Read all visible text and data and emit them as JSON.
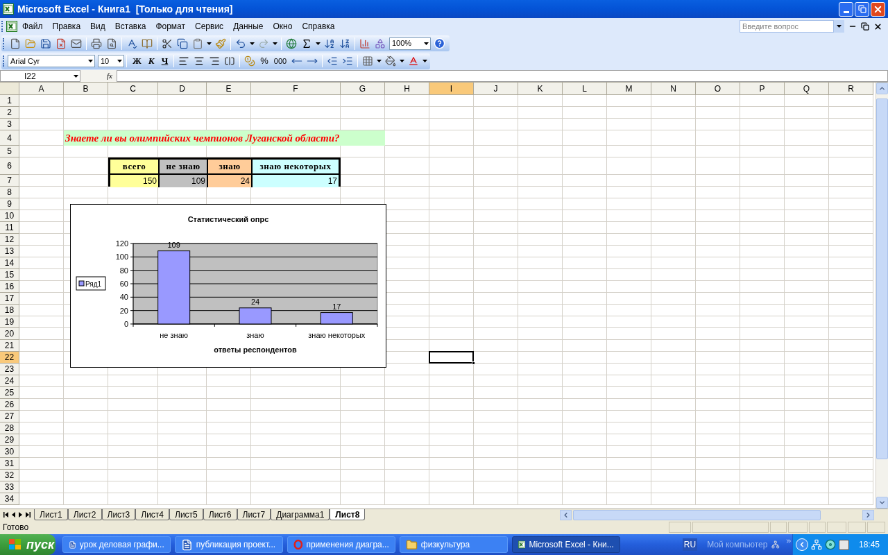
{
  "window": {
    "title": "Microsoft Excel - Книга1  [Только для чтения]"
  },
  "menu": [
    "Файл",
    "Правка",
    "Вид",
    "Вставка",
    "Формат",
    "Сервис",
    "Данные",
    "Окно",
    "Справка"
  ],
  "help_box": {
    "placeholder": "Введите вопрос"
  },
  "toolbar": {
    "zoom": "100%",
    "font": "Arial Cyr",
    "size": "10",
    "bold": "Ж",
    "italic": "К",
    "underline": "Ч",
    "percent": "%",
    "thousands": "000"
  },
  "formula_bar": {
    "name_box": "I22",
    "fx": "fx"
  },
  "columns": [
    {
      "label": "A",
      "selected": false
    },
    {
      "label": "B",
      "selected": false
    },
    {
      "label": "C",
      "selected": false
    },
    {
      "label": "D",
      "selected": false
    },
    {
      "label": "E",
      "selected": false
    },
    {
      "label": "F",
      "selected": false
    },
    {
      "label": "G",
      "selected": false
    },
    {
      "label": "H",
      "selected": false
    },
    {
      "label": "I",
      "selected": true
    },
    {
      "label": "J",
      "selected": false
    },
    {
      "label": "K",
      "selected": false
    },
    {
      "label": "L",
      "selected": false
    },
    {
      "label": "M",
      "selected": false
    },
    {
      "label": "N",
      "selected": false
    },
    {
      "label": "O",
      "selected": false
    },
    {
      "label": "P",
      "selected": false
    },
    {
      "label": "Q",
      "selected": false
    },
    {
      "label": "R",
      "selected": false
    }
  ],
  "rows": [
    {
      "label": "1",
      "selected": false
    },
    {
      "label": "2",
      "selected": false
    },
    {
      "label": "3",
      "selected": false
    },
    {
      "label": "4",
      "selected": false
    },
    {
      "label": "5",
      "selected": false
    },
    {
      "label": "6",
      "selected": false
    },
    {
      "label": "7",
      "selected": false
    },
    {
      "label": "8",
      "selected": false
    },
    {
      "label": "9",
      "selected": false
    },
    {
      "label": "10",
      "selected": false
    },
    {
      "label": "11",
      "selected": false
    },
    {
      "label": "12",
      "selected": false
    },
    {
      "label": "13",
      "selected": false
    },
    {
      "label": "14",
      "selected": false
    },
    {
      "label": "15",
      "selected": false
    },
    {
      "label": "16",
      "selected": false
    },
    {
      "label": "17",
      "selected": false
    },
    {
      "label": "18",
      "selected": false
    },
    {
      "label": "19",
      "selected": false
    },
    {
      "label": "20",
      "selected": false
    },
    {
      "label": "21",
      "selected": false
    },
    {
      "label": "22",
      "selected": true
    },
    {
      "label": "23",
      "selected": false
    },
    {
      "label": "24",
      "selected": false
    },
    {
      "label": "25",
      "selected": false
    },
    {
      "label": "26",
      "selected": false
    },
    {
      "label": "27",
      "selected": false
    },
    {
      "label": "28",
      "selected": false
    },
    {
      "label": "29",
      "selected": false
    },
    {
      "label": "30",
      "selected": false
    },
    {
      "label": "31",
      "selected": false
    },
    {
      "label": "32",
      "selected": false
    },
    {
      "label": "33",
      "selected": false
    },
    {
      "label": "34",
      "selected": false
    }
  ],
  "question": "Знаете ли вы олимпийских чемпионов Луганской области?",
  "table": {
    "headers": [
      {
        "text": "всего",
        "color": "#ffff99"
      },
      {
        "text": "не знаю",
        "color": "#c0c0c0"
      },
      {
        "text": "знаю",
        "color": "#ffcc99"
      },
      {
        "text": "знаю некоторых",
        "color": "#ccffff"
      }
    ],
    "values": [
      {
        "text": "150",
        "color": "#ffff99"
      },
      {
        "text": "109",
        "color": "#c0c0c0"
      },
      {
        "text": "24",
        "color": "#ffcc99"
      },
      {
        "text": "17",
        "color": "#ccffff"
      }
    ]
  },
  "chart": {
    "chart_data": {
      "type": "bar",
      "title": "Статистический опрс",
      "xlabel": "ответы респондентов",
      "categories": [
        "не знаю",
        "знаю",
        "знаю некоторых"
      ],
      "series": [
        {
          "name": "Ряд1",
          "color": "#9999ff",
          "values": [
            109,
            24,
            17
          ]
        }
      ],
      "ylim": [
        0,
        120
      ],
      "yticks": [
        0,
        20,
        40,
        60,
        80,
        100,
        120
      ],
      "grid": true,
      "value_labels": [
        "109",
        "24",
        "17"
      ]
    }
  },
  "sheet_tabs": [
    {
      "label": "Лист1",
      "selected": false
    },
    {
      "label": "Лист2",
      "selected": false
    },
    {
      "label": "Лист3",
      "selected": false
    },
    {
      "label": "Лист4",
      "selected": false
    },
    {
      "label": "Лист5",
      "selected": false
    },
    {
      "label": "Лист6",
      "selected": false
    },
    {
      "label": "Лист7",
      "selected": false
    },
    {
      "label": "Диаграмма1",
      "selected": false
    },
    {
      "label": "Лист8",
      "selected": true
    }
  ],
  "status": "Готово",
  "taskbar": {
    "start": "пуск",
    "items": [
      {
        "label": "урок деловая графи...",
        "kind": "word",
        "selected": false
      },
      {
        "label": "публикация проект...",
        "kind": "word",
        "selected": false
      },
      {
        "label": "применения диагра...",
        "kind": "browser",
        "selected": false
      },
      {
        "label": "физкультура",
        "kind": "folder",
        "selected": false
      },
      {
        "label": "Microsoft Excel - Кни...",
        "kind": "excel",
        "selected": true
      }
    ],
    "language": "RU",
    "address": "Мой компьютер",
    "clock": "18:45"
  }
}
